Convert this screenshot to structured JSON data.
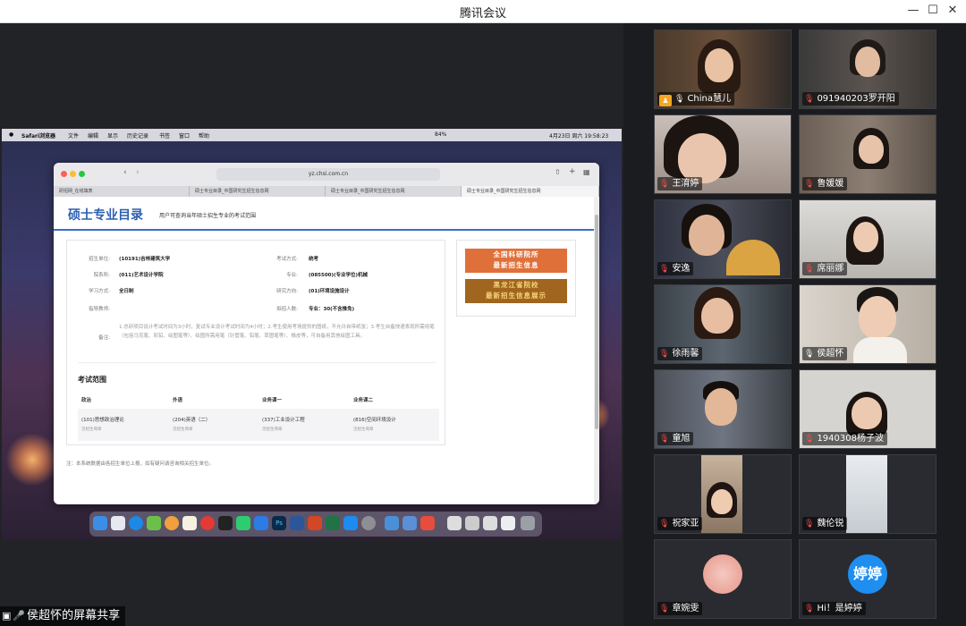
{
  "app": {
    "title": "腾讯会议",
    "controls": [
      "—",
      "☐",
      "✕"
    ]
  },
  "share": {
    "label": "侯超怀的屏幕共享"
  },
  "mac": {
    "menubar": {
      "app": "Safari浏览器",
      "items": [
        "文件",
        "编辑",
        "显示",
        "历史记录",
        "书签",
        "窗口",
        "帮助"
      ],
      "battery": "84%",
      "datetime": "4月23日 周六 19:58:23"
    },
    "browser": {
      "url": "yz.chsi.com.cn",
      "tabs": [
        "研招网_在线填表",
        "硕士专业目录_中国研究生招生信息网",
        "硕士专业目录_中国研究生招生信息网",
        "硕士专业目录_中国研究生招生信息网"
      ],
      "page": {
        "title": "硕士专业目录",
        "subtitle": "用户可查询当年硕士招生专业的考试范围",
        "fields": {
          "unit_label": "招生单位:",
          "unit_value": "(10191)吉林建筑大学",
          "exam_mode_label": "考试方式:",
          "exam_mode_value": "统考",
          "dept_label": "院系所:",
          "dept_value": "(011)艺术设计学院",
          "major_label": "专业:",
          "major_value": "(085500)(专业学位)机械",
          "study_label": "学习方式:",
          "study_value": "全日制",
          "direction_label": "研究方向:",
          "direction_value": "(01)环境设施设计",
          "advisor_label": "指导教师:",
          "advisor_value": "",
          "enroll_label": "拟招人数:",
          "enroll_value": "专业：30(不含推免)",
          "note_label": "备注:",
          "note_value": "1.总研项目设计考试时间为3小时，复试专业设计考试时间为4小时；2.考生使用考场提供的图纸，不允许自带纸张；3.考生自备快速表现所需用笔（包括马克笔、彩铅、绘图笔等）、绘图所需用笔（针管笔、铅笔、草图笔等）、橡皮等，可自备用其他绘图工具。"
        },
        "exam": {
          "title": "考试范围",
          "headers": [
            "政治",
            "外语",
            "业务课一",
            "业务课二"
          ],
          "values": [
            "(101)思想政治理论",
            "(204)英语（二）",
            "(337)工业设计工程",
            "(816)空间环境设计"
          ],
          "subs": [
            "见招生简章",
            "见招生简章",
            "见招生简章",
            "见招生简章"
          ]
        },
        "footnote": "注：本系统数据由各招生单位上报，如有疑问请咨询相关招生单位。",
        "banners": [
          {
            "line1": "全国科研院所",
            "line2": "最新招生信息"
          },
          {
            "line1": "黑龙江省院校",
            "line2": "最新招生信息展示"
          }
        ]
      }
    }
  },
  "participants": [
    {
      "name": "China慧儿",
      "mic": "on",
      "host": true
    },
    {
      "name": "091940203罗开阳",
      "mic": "muted",
      "host": false
    },
    {
      "name": "王淯婷",
      "mic": "muted",
      "host": false
    },
    {
      "name": "鲁媛媛",
      "mic": "muted",
      "host": false
    },
    {
      "name": "安逸",
      "mic": "muted",
      "host": false
    },
    {
      "name": "席丽娜",
      "mic": "muted",
      "host": false
    },
    {
      "name": "徐雨馨",
      "mic": "muted",
      "host": false
    },
    {
      "name": "侯超怀",
      "mic": "on",
      "host": false
    },
    {
      "name": "童旭",
      "mic": "muted",
      "host": false
    },
    {
      "name": "1940308杨子波",
      "mic": "muted",
      "host": false
    },
    {
      "name": "祝家亚",
      "mic": "muted",
      "host": false
    },
    {
      "name": "魏伦锐",
      "mic": "muted",
      "host": false
    },
    {
      "name": "章婉雯",
      "mic": "muted",
      "host": false
    },
    {
      "name": "Hi！是婷婷",
      "mic": "muted",
      "host": false,
      "avatar_text": "婷婷"
    }
  ],
  "colors": {
    "brand_blue": "#2b5fb0",
    "mute_red": "#ff4d4d",
    "host_orange": "#f5a623",
    "avatar_blue": "#1f8ef1"
  }
}
